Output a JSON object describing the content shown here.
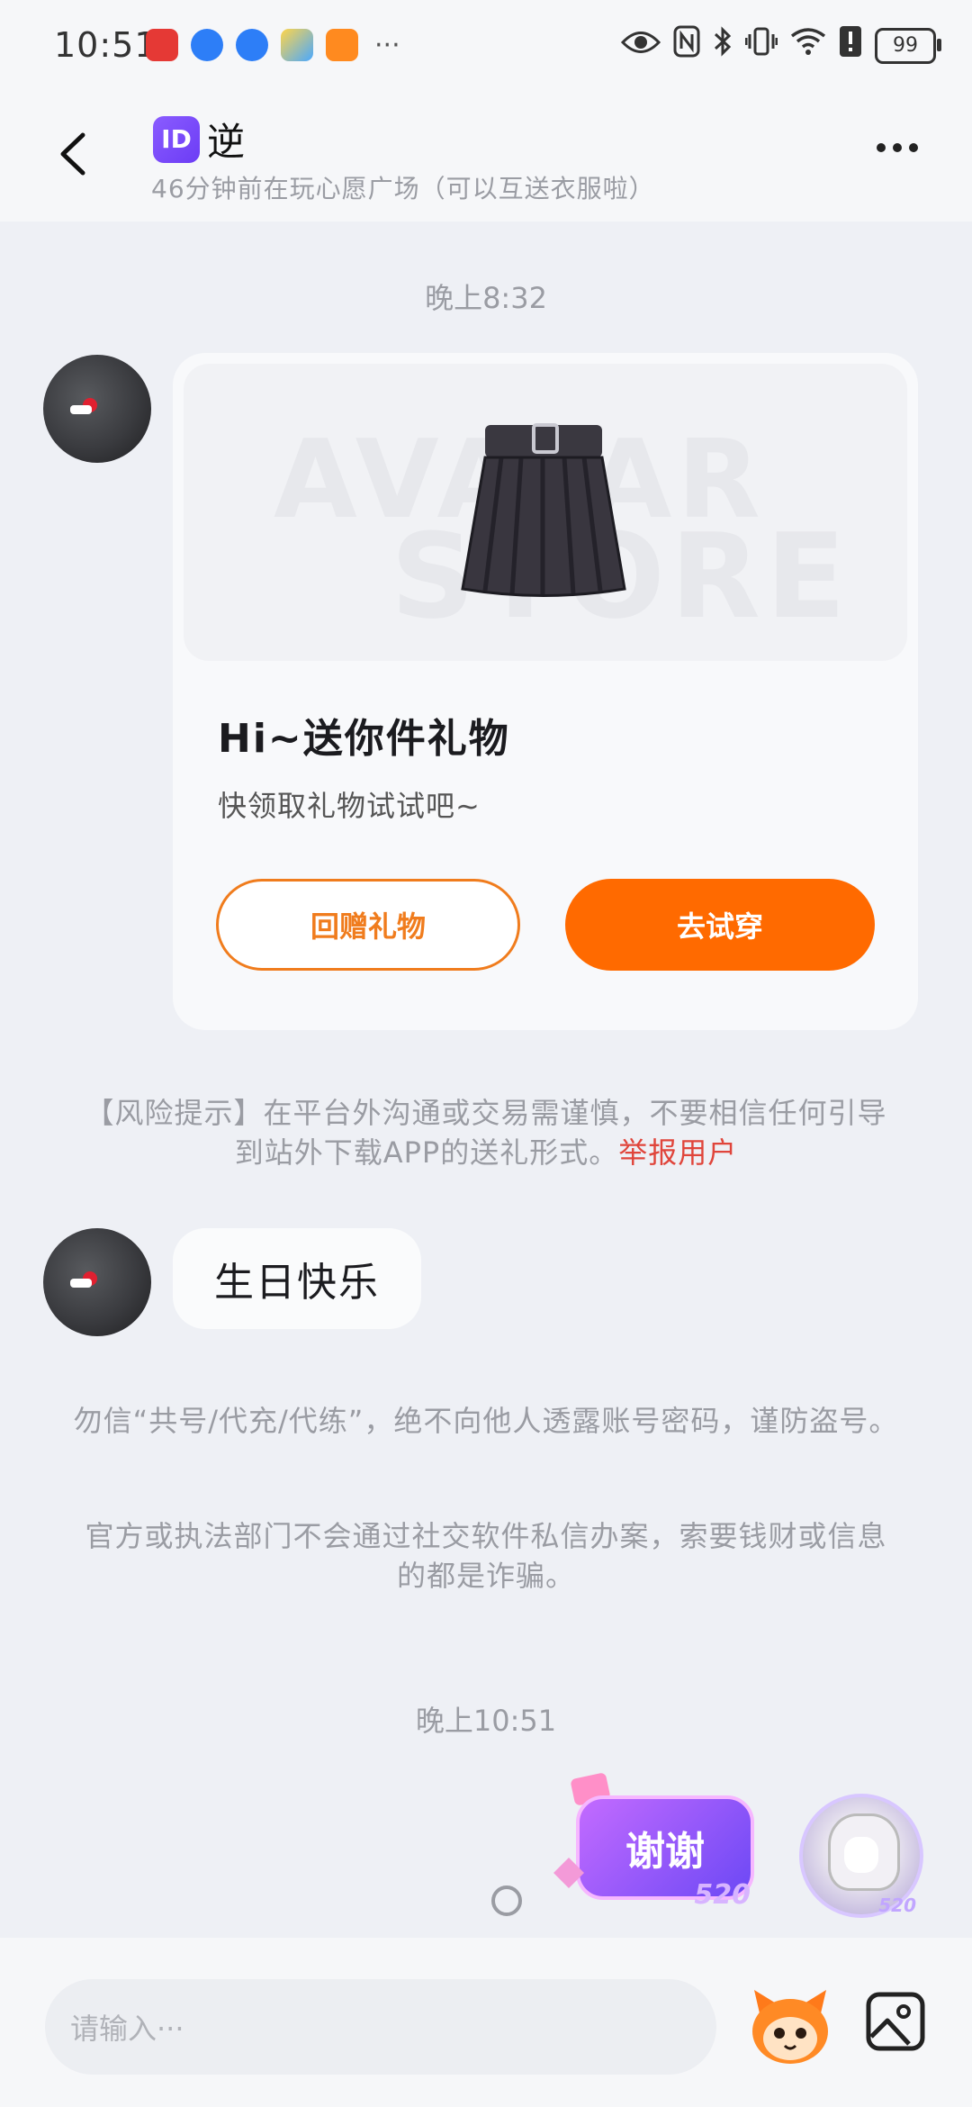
{
  "status_bar": {
    "time": "10:51",
    "more": "···",
    "battery": "99"
  },
  "header": {
    "badge": "ID",
    "title": "逆",
    "subtitle": "46分钟前在玩心愿广场（可以互送衣服啦）"
  },
  "messages": {
    "timestamp_1": "晚上8:32",
    "gift_card": {
      "title": "Hi~送你件礼物",
      "desc": "快领取礼物试试吧~",
      "btn_return": "回赠礼物",
      "btn_try": "去试穿",
      "watermark_1": "AVATAR",
      "watermark_2": "STORE"
    },
    "risk_notice": "【风险提示】在平台外沟通或交易需谨慎，不要相信任何引导到站外下载APP的送礼形式。",
    "report_link": "举报用户",
    "text_message": "生日快乐",
    "tip_1": "勿信“共号/代充/代练”，绝不向他人透露账号密码，谨防盗号。",
    "tip_2": "官方或执法部门不会通过社交软件私信办案，索要钱财或信息的都是诈骗。",
    "timestamp_2": "晚上10:51",
    "sticker_text": "谢谢",
    "sticker_badge": "520",
    "avatar_badge": "520"
  },
  "input": {
    "placeholder": "请输入···"
  },
  "colors": {
    "accent_orange": "#ff6a00",
    "report_red": "#e0453b",
    "id_badge_purple": "#7b4cf7"
  },
  "icons": [
    "back-arrow-icon",
    "more-dots-icon",
    "mascot-icon",
    "image-icon"
  ]
}
